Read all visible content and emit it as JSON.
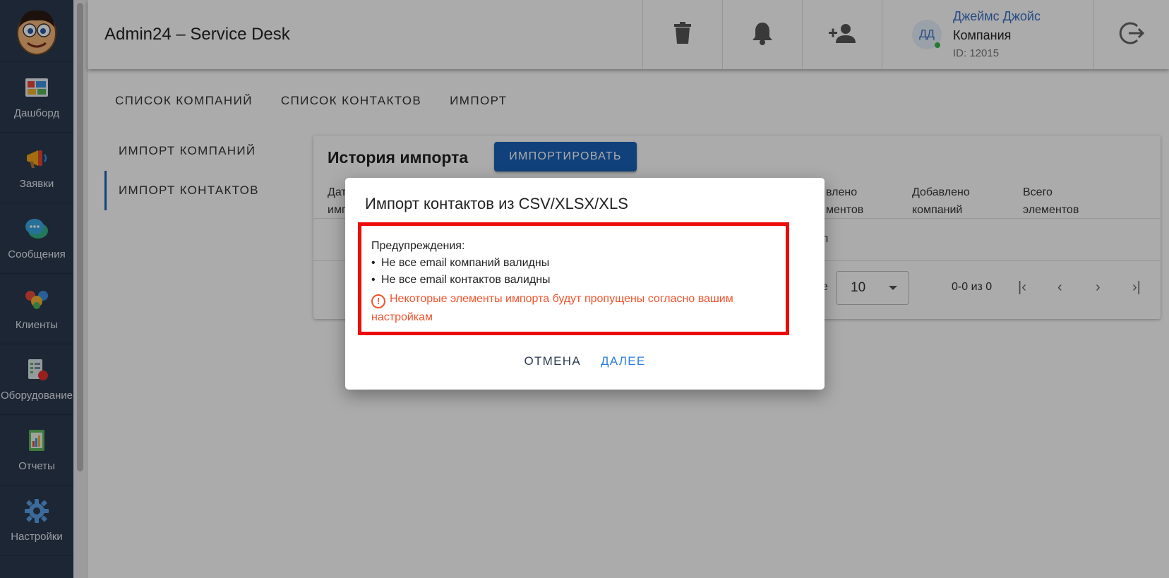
{
  "app": {
    "title": "Admin24 – Service Desk"
  },
  "sidebar": {
    "logo": "avatar-logo",
    "items": [
      {
        "label": "Дашборд",
        "icon": "dashboard-icon"
      },
      {
        "label": "Заявки",
        "icon": "megaphone-icon"
      },
      {
        "label": "Сообщения",
        "icon": "chat-bubbles-icon"
      },
      {
        "label": "Клиенты",
        "icon": "clients-icon"
      },
      {
        "label": "Оборудование",
        "icon": "equipment-checklist-icon"
      },
      {
        "label": "Отчеты",
        "icon": "report-chart-icon"
      },
      {
        "label": "Настройки",
        "icon": "gear-icon"
      }
    ]
  },
  "header": {
    "user": {
      "initials": "ДД",
      "name": "Джеймс Джойс",
      "company": "Компания",
      "id": "ID: 12015"
    },
    "icons": [
      "trash-icon",
      "bell-icon",
      "add-user-icon",
      "logout-icon"
    ]
  },
  "tabs": [
    "СПИСОК КОМПАНИЙ",
    "СПИСОК КОНТАКТОВ",
    "ИМПОРТ"
  ],
  "subnav": [
    "ИМПОРТ КОМПАНИЙ",
    "ИМПОРТ КОНТАКТОВ"
  ],
  "card": {
    "title": "История импорта",
    "import_button": "ИМПОРТИРОВАТЬ",
    "columns": {
      "date_line1": "Дат",
      "date_line2": "имп",
      "added_elements_line1": "влено",
      "added_elements_line2": "ментов",
      "added_companies_line1": "Добавлено",
      "added_companies_line2": "компаний",
      "total_line1": "Всего",
      "total_line2": "элементов"
    },
    "partial_cell": "л",
    "pager": {
      "rows_label_tail": "е",
      "per_page": "10",
      "count": "0-0 из 0"
    }
  },
  "dialog": {
    "title": "Импорт контактов из CSV/XLSX/XLS",
    "warnings_header": "Предупреждения:",
    "warnings": [
      "Не все email компаний валидны",
      "Не все email контактов валидны"
    ],
    "error": "Некоторые элементы импорта будут пропущены согласно вашим настройкам",
    "cancel": "ОТМЕНА",
    "next": "ДАЛЕЕ"
  }
}
